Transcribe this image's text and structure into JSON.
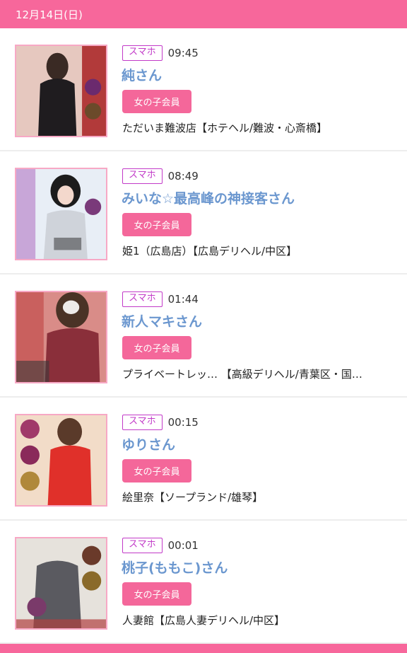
{
  "header": {
    "date": "12月14日(日)"
  },
  "colors": {
    "accent": "#f7679b",
    "name_blue": "#6b97cf",
    "tag_purple": "#c23ac8"
  },
  "entries": [
    {
      "device": "スマホ",
      "time": "09:45",
      "name": "純さん",
      "badge": "女の子会員",
      "shop": "ただいま難波店【ホテヘル/難波・心斎橋】",
      "thumb_icon": "profile-photo"
    },
    {
      "device": "スマホ",
      "time": "08:49",
      "name": "みいな☆最高峰の神接客さん",
      "badge": "女の子会員",
      "shop": "姫1（広島店）【広島デリヘル/中区】",
      "thumb_icon": "profile-photo"
    },
    {
      "device": "スマホ",
      "time": "01:44",
      "name": "新人マキさん",
      "badge": "女の子会員",
      "shop": "プライベートレッ… 【高級デリヘル/青葉区・国…",
      "thumb_icon": "profile-photo"
    },
    {
      "device": "スマホ",
      "time": "00:15",
      "name": "ゆりさん",
      "badge": "女の子会員",
      "shop": "絵里奈【ソープランド/雄琴】",
      "thumb_icon": "profile-photo"
    },
    {
      "device": "スマホ",
      "time": "00:01",
      "name": "桃子(ももこ)さん",
      "badge": "女の子会員",
      "shop": "人妻館【広島人妻デリヘル/中区】",
      "thumb_icon": "profile-photo"
    }
  ]
}
